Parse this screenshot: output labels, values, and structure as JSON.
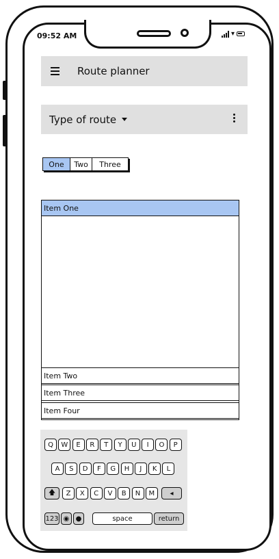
{
  "status_bar": {
    "time": "09:52 AM"
  },
  "app_bar": {
    "title": "Route planner"
  },
  "route_bar": {
    "label": "Type of route"
  },
  "segments": [
    {
      "label": "One",
      "active": true
    },
    {
      "label": "Two",
      "active": false
    },
    {
      "label": "Three",
      "active": false
    }
  ],
  "list": {
    "items": [
      "Item One",
      "Item Two",
      "Item Three",
      "Item Four"
    ],
    "selected": "Item One"
  },
  "keyboard": {
    "row1": [
      "Q",
      "W",
      "E",
      "R",
      "T",
      "Y",
      "U",
      "I",
      "O",
      "P"
    ],
    "row2": [
      "A",
      "S",
      "D",
      "F",
      "G",
      "H",
      "J",
      "K",
      "L"
    ],
    "row3": [
      "Z",
      "X",
      "C",
      "V",
      "B",
      "N",
      "M"
    ],
    "numbers_key": "123",
    "space_key": "space",
    "return_key": "return"
  },
  "colors": {
    "selection": "#a8c6f2",
    "bar": "#e0e0e0",
    "keyboard_bg": "#e6e6e6"
  }
}
